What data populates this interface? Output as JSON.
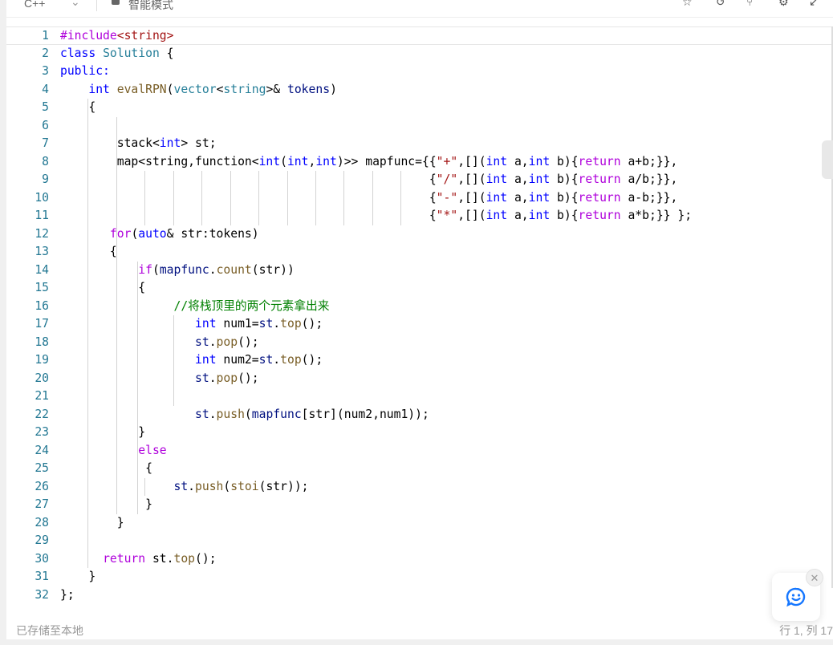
{
  "toolbar": {
    "language": "C++",
    "mode": "智能模式",
    "icons": [
      "bookmark-icon",
      "reset-icon",
      "branch-icon",
      "settings-icon",
      "collapse-icon"
    ]
  },
  "editor": {
    "lines": [
      [
        [
          "#include",
          "pp"
        ],
        [
          "<string>",
          "str"
        ]
      ],
      [
        [
          "class ",
          "ty"
        ],
        [
          "Solution",
          "cls"
        ],
        [
          " {",
          ""
        ]
      ],
      [
        [
          "public:",
          "ty"
        ]
      ],
      [
        [
          "    ",
          ""
        ],
        [
          "int ",
          "ty"
        ],
        [
          "evalRPN",
          "fn"
        ],
        [
          "(",
          ""
        ],
        [
          "vector",
          "cls"
        ],
        [
          "<",
          ""
        ],
        [
          "string",
          "cls"
        ],
        [
          ">& ",
          ""
        ],
        [
          "tokens",
          "id"
        ],
        [
          ")",
          ""
        ]
      ],
      [
        [
          "    {",
          ""
        ]
      ],
      [
        [
          "",
          ""
        ]
      ],
      [
        [
          "        stack<",
          ""
        ],
        [
          "int",
          "ty"
        ],
        [
          "> st;",
          ""
        ]
      ],
      [
        [
          "        map<string,function<",
          ""
        ],
        [
          "int",
          "ty"
        ],
        [
          "(",
          ""
        ],
        [
          "int",
          "ty"
        ],
        [
          ",",
          ""
        ],
        [
          "int",
          "ty"
        ],
        [
          ")>> mapfunc={{",
          ""
        ],
        [
          "\"+\"",
          "str"
        ],
        [
          ",[](",
          ""
        ],
        [
          "int",
          "ty"
        ],
        [
          " a,",
          ""
        ],
        [
          "int",
          "ty"
        ],
        [
          " b){",
          ""
        ],
        [
          "return",
          "kw"
        ],
        [
          " a+b;}},",
          ""
        ]
      ],
      [
        [
          "                                                    {",
          ""
        ],
        [
          "\"/\"",
          "str"
        ],
        [
          ",[](",
          ""
        ],
        [
          "int",
          "ty"
        ],
        [
          " a,",
          ""
        ],
        [
          "int",
          "ty"
        ],
        [
          " b){",
          ""
        ],
        [
          "return",
          "kw"
        ],
        [
          " a/b;}},",
          ""
        ]
      ],
      [
        [
          "                                                    {",
          ""
        ],
        [
          "\"-\"",
          "str"
        ],
        [
          ",[](",
          ""
        ],
        [
          "int",
          "ty"
        ],
        [
          " a,",
          ""
        ],
        [
          "int",
          "ty"
        ],
        [
          " b){",
          ""
        ],
        [
          "return",
          "kw"
        ],
        [
          " a-b;}},",
          ""
        ]
      ],
      [
        [
          "                                                    {",
          ""
        ],
        [
          "\"*\"",
          "str"
        ],
        [
          ",[](",
          ""
        ],
        [
          "int",
          "ty"
        ],
        [
          " a,",
          ""
        ],
        [
          "int",
          "ty"
        ],
        [
          " b){",
          ""
        ],
        [
          "return",
          "kw"
        ],
        [
          " a*b;}} };",
          ""
        ]
      ],
      [
        [
          "       ",
          ""
        ],
        [
          "for",
          "kw"
        ],
        [
          "(",
          ""
        ],
        [
          "auto",
          "ty"
        ],
        [
          "& str:tokens)",
          ""
        ]
      ],
      [
        [
          "       {",
          ""
        ]
      ],
      [
        [
          "           ",
          ""
        ],
        [
          "if",
          "kw"
        ],
        [
          "(",
          ""
        ],
        [
          "mapfunc",
          "id"
        ],
        [
          ".",
          ""
        ],
        [
          "count",
          "fn"
        ],
        [
          "(str))",
          ""
        ]
      ],
      [
        [
          "           {",
          ""
        ]
      ],
      [
        [
          "                ",
          ""
        ],
        [
          "//将栈顶里的两个元素拿出来",
          "cm"
        ]
      ],
      [
        [
          "                   ",
          ""
        ],
        [
          "int",
          "ty"
        ],
        [
          " num1=",
          ""
        ],
        [
          "st",
          "id"
        ],
        [
          ".",
          ""
        ],
        [
          "top",
          "fn"
        ],
        [
          "();",
          ""
        ]
      ],
      [
        [
          "                   ",
          ""
        ],
        [
          "st",
          "id"
        ],
        [
          ".",
          ""
        ],
        [
          "pop",
          "fn"
        ],
        [
          "();",
          ""
        ]
      ],
      [
        [
          "                   ",
          ""
        ],
        [
          "int",
          "ty"
        ],
        [
          " num2=",
          ""
        ],
        [
          "st",
          "id"
        ],
        [
          ".",
          ""
        ],
        [
          "top",
          "fn"
        ],
        [
          "();",
          ""
        ]
      ],
      [
        [
          "                   ",
          ""
        ],
        [
          "st",
          "id"
        ],
        [
          ".",
          ""
        ],
        [
          "pop",
          "fn"
        ],
        [
          "();",
          ""
        ]
      ],
      [
        [
          "",
          ""
        ]
      ],
      [
        [
          "                   ",
          ""
        ],
        [
          "st",
          "id"
        ],
        [
          ".",
          ""
        ],
        [
          "push",
          "fn"
        ],
        [
          "(",
          ""
        ],
        [
          "mapfunc",
          "id"
        ],
        [
          "[str](num2,num1));",
          ""
        ]
      ],
      [
        [
          "           }",
          ""
        ]
      ],
      [
        [
          "           ",
          ""
        ],
        [
          "else",
          "kw"
        ]
      ],
      [
        [
          "            {",
          ""
        ]
      ],
      [
        [
          "                ",
          ""
        ],
        [
          "st",
          "id"
        ],
        [
          ".",
          ""
        ],
        [
          "push",
          "fn"
        ],
        [
          "(",
          ""
        ],
        [
          "stoi",
          "fn"
        ],
        [
          "(str));",
          ""
        ]
      ],
      [
        [
          "            }",
          ""
        ]
      ],
      [
        [
          "        }",
          ""
        ]
      ],
      [
        [
          "",
          ""
        ]
      ],
      [
        [
          "      ",
          ""
        ],
        [
          "return",
          "kw"
        ],
        [
          " st.",
          ""
        ],
        [
          "top",
          "fn"
        ],
        [
          "();",
          ""
        ]
      ],
      [
        [
          "    }",
          ""
        ]
      ],
      [
        [
          "};",
          ""
        ]
      ]
    ]
  },
  "status": {
    "saved": "已存储至本地",
    "position": "行 1, 列 17"
  },
  "chat": {
    "icon": "chat-smile-icon",
    "close_icon": "close-icon",
    "accent": "#1677ff"
  }
}
